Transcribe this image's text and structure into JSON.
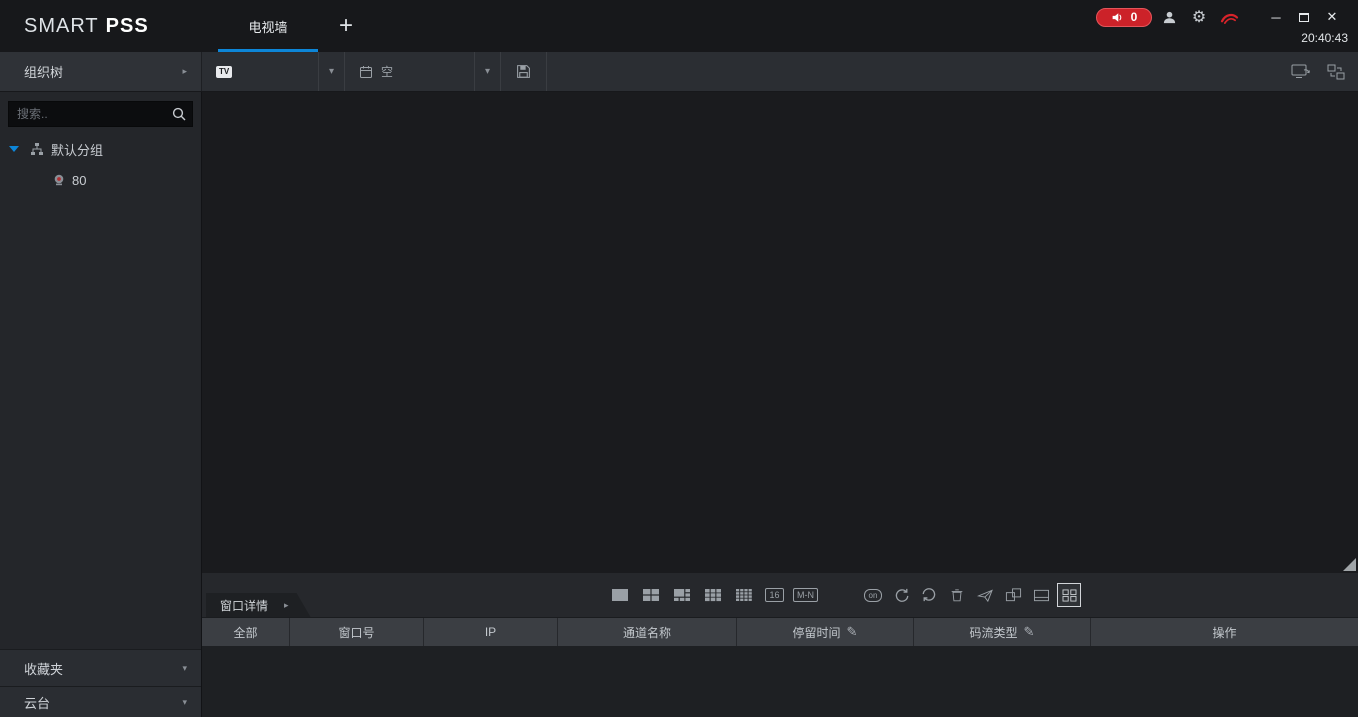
{
  "app": {
    "logo_primary": "SMART",
    "logo_secondary": "PSS",
    "time": "20:40:43"
  },
  "titlebar": {
    "active_tab": "电视墙",
    "alarm_count": "0"
  },
  "icons": {
    "plus": "+",
    "gear": "⚙",
    "close": "✕",
    "minimize": "─",
    "dropdown_arrow": "▾",
    "panel_arrow": "▸",
    "expander_down": "▼",
    "pencil": "✎",
    "tv_badge": "TV",
    "decode_on": "on"
  },
  "toolbar": {
    "panel_header": "组织树",
    "scheme_value": "空"
  },
  "sidebar": {
    "search_placeholder": "搜索..",
    "group_label": "默认分组",
    "device_label": "80",
    "favorites_label": "收藏夹",
    "ptz_label": "云台"
  },
  "bottombar": {
    "details_tab": "窗口详情",
    "layout_16": "16",
    "layout_mn": "M-N"
  },
  "table": {
    "headers": [
      "全部",
      "窗口号",
      "IP",
      "通道名称",
      "停留时间",
      "码流类型",
      "操作"
    ]
  },
  "colors": {
    "accent": "#0d86d8",
    "alarm_red": "#cc2229",
    "topbar_bg": "#17181b",
    "toolbar_bg": "#2b2e33",
    "sidebar_bg": "#24262a",
    "video_bg": "#1a1b1e",
    "table_header_bg": "#3b3e43"
  }
}
